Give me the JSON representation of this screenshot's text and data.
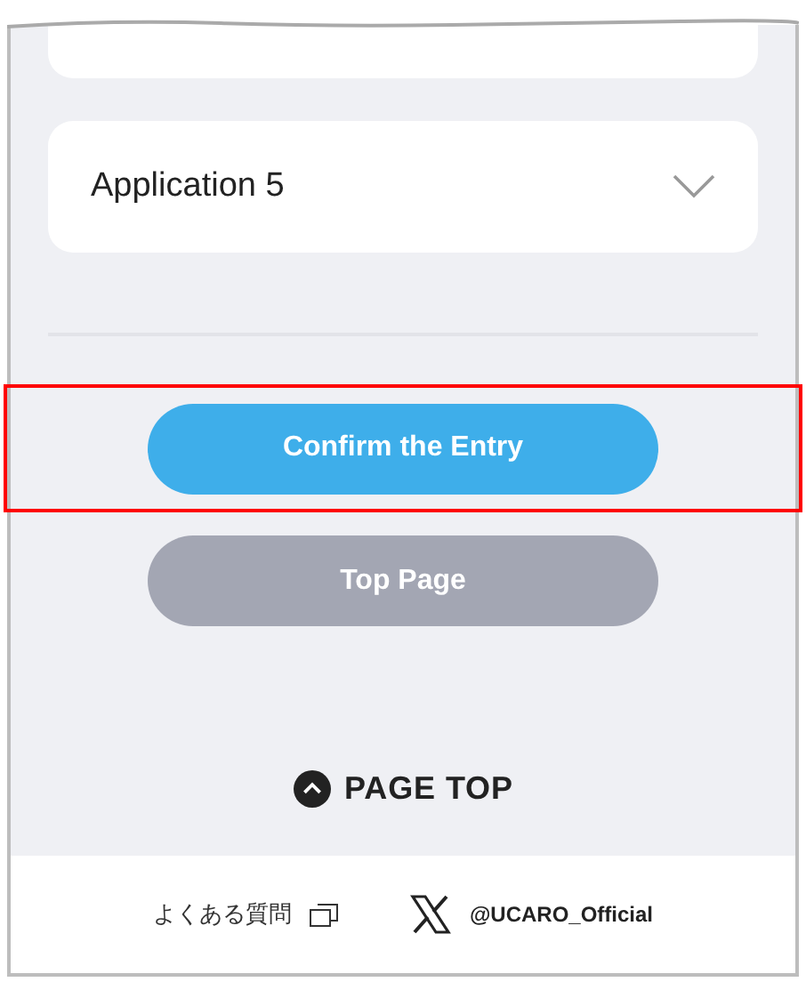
{
  "applications": [
    {
      "label": "Application 5",
      "expanded": false
    }
  ],
  "buttons": [
    {
      "label": "Confirm the Entry",
      "kind": "primary",
      "highlighted": true
    },
    {
      "label": "Top Page",
      "kind": "secondary",
      "highlighted": false
    }
  ],
  "page_top": {
    "label": "PAGE TOP"
  },
  "footer": {
    "faq": "よくある質問",
    "x_account": "@UCARO_Official"
  }
}
